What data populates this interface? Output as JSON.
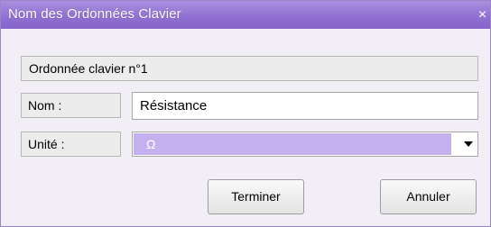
{
  "dialog": {
    "title": "Nom des Ordonnées Clavier",
    "close_glyph": "×",
    "section_label": "Ordonnée clavier n°1",
    "name_label": "Nom :",
    "name_value": "Résistance",
    "unit_label": "Unité :",
    "unit_value": "Ω",
    "ok_label": "Terminer",
    "cancel_label": "Annuler"
  },
  "colors": {
    "titlebar": "#8f6fd0",
    "selection": "#c5b0ef"
  },
  "icons": {
    "close": "close-icon",
    "dropdown": "chevron-down-icon"
  }
}
